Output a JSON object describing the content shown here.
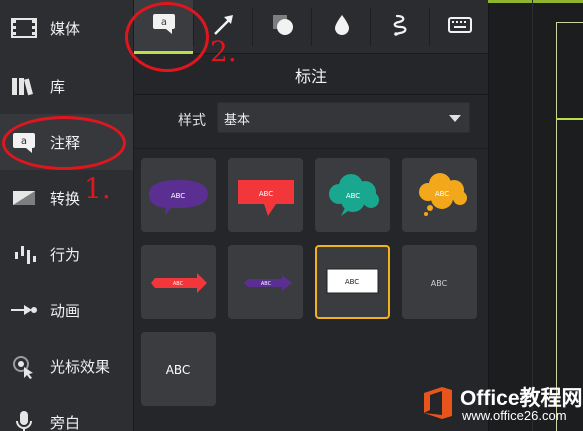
{
  "sidebar": {
    "items": [
      {
        "label": "媒体",
        "icon": "film-icon"
      },
      {
        "label": "库",
        "icon": "library-icon"
      },
      {
        "label": "注释",
        "icon": "annotation-icon"
      },
      {
        "label": "转换",
        "icon": "transition-icon"
      },
      {
        "label": "行为",
        "icon": "behavior-icon"
      },
      {
        "label": "动画",
        "icon": "animation-icon"
      },
      {
        "label": "光标效果",
        "icon": "cursor-effect-icon"
      },
      {
        "label": "旁白",
        "icon": "microphone-icon"
      }
    ],
    "active_index": 2
  },
  "tabs": [
    {
      "icon": "callout-icon"
    },
    {
      "icon": "arrow-icon"
    },
    {
      "icon": "shape-icon"
    },
    {
      "icon": "blur-icon"
    },
    {
      "icon": "sketch-motion-icon"
    },
    {
      "icon": "keystroke-icon"
    }
  ],
  "panel": {
    "title": "标注",
    "style_label": "样式",
    "style_value": "基本"
  },
  "tiles": [
    {
      "kind": "speech-bubble",
      "text": "ABC",
      "color": "#5a2f91"
    },
    {
      "kind": "banner-callout",
      "text": "ABC",
      "color": "#f2363a"
    },
    {
      "kind": "cloud",
      "text": "ABC",
      "color": "#1aa78f"
    },
    {
      "kind": "thought-cloud",
      "text": "ABC",
      "color": "#f2a81a"
    },
    {
      "kind": "arrow",
      "text": "ABC",
      "color": "#f2363a"
    },
    {
      "kind": "arrow",
      "text": "ABC",
      "color": "#5a2f91"
    },
    {
      "kind": "text-box",
      "text": "ABC",
      "color": "#ffffff",
      "selected": true
    },
    {
      "kind": "text",
      "text": "ABC",
      "color": "#cfcfcf"
    },
    {
      "kind": "text-large",
      "text": "ABC",
      "color": "#ffffff"
    }
  ],
  "annotations": {
    "step1": "1.",
    "step2": "2.",
    "color": "#e0161e"
  },
  "watermark": {
    "text": "Office教程网",
    "url": "www.office26.com"
  },
  "colors": {
    "accent": "#b8e04a",
    "selected_border": "#f2b21b"
  }
}
